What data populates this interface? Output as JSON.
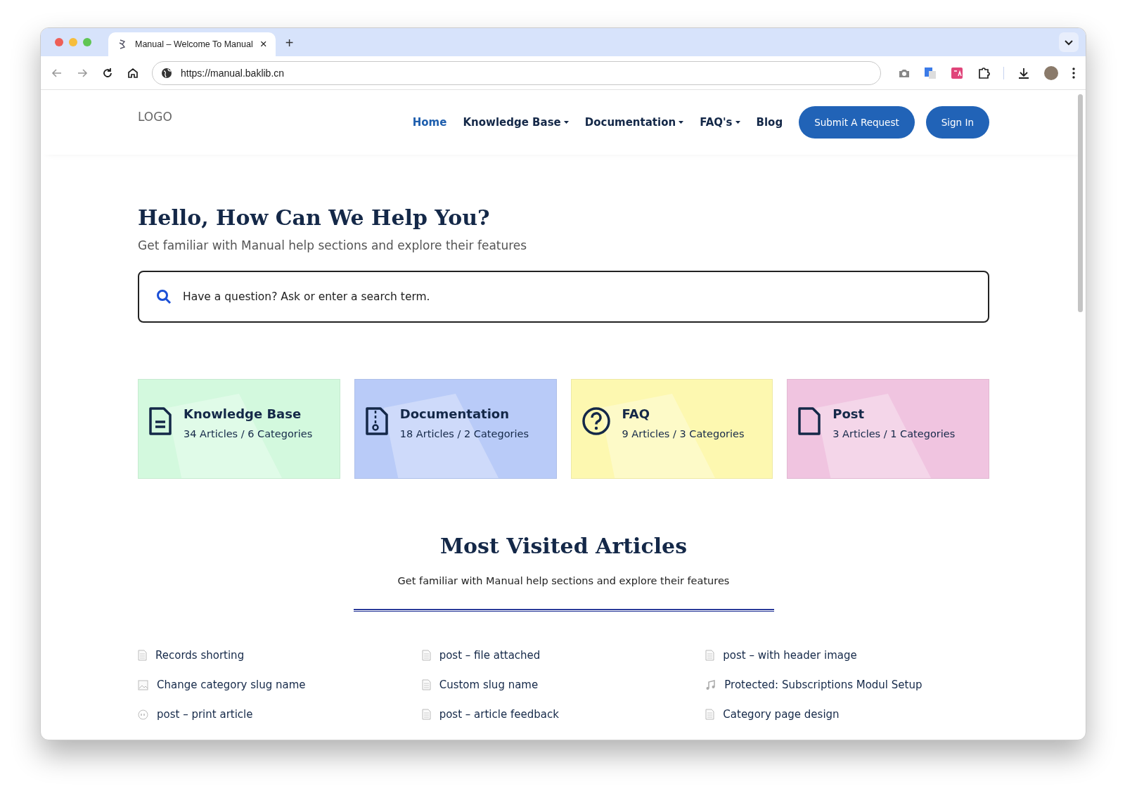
{
  "browser": {
    "tab": {
      "title": "Manual – Welcome To Manual",
      "close": "×"
    },
    "new_tab": "+",
    "address": "https://manual.baklib.cn"
  },
  "header": {
    "logo": "LOGO",
    "nav": [
      {
        "label": "Home",
        "selected": true,
        "dropdown": false
      },
      {
        "label": "Knowledge Base",
        "selected": false,
        "dropdown": true
      },
      {
        "label": "Documentation",
        "selected": false,
        "dropdown": true
      },
      {
        "label": "FAQ's",
        "selected": false,
        "dropdown": true
      },
      {
        "label": "Blog",
        "selected": false,
        "dropdown": false
      }
    ],
    "buttons": [
      "Submit A Request",
      "Sign In"
    ]
  },
  "hero": {
    "title": "Hello, How Can We Help You?",
    "subtitle": "Get familiar with Manual help sections and explore their features",
    "search": {
      "placeholder": "Have a question? Ask or enter a search term."
    }
  },
  "categories": [
    {
      "kind": "document",
      "title": "Knowledge Base",
      "counts": "34 Articles / 6 Categories",
      "color": "#d3f9de"
    },
    {
      "kind": "zip",
      "title": "Documentation",
      "counts": "18 Articles / 2 Categories",
      "color": "#b9cbf8"
    },
    {
      "kind": "question",
      "title": "FAQ",
      "counts": "9 Articles / 3 Categories",
      "color": "#fdf8b0"
    },
    {
      "kind": "file",
      "title": "Post",
      "counts": "3 Articles / 1 Categories",
      "color": "#f0c4e0"
    }
  ],
  "most_visited": {
    "title": "Most Visited Articles",
    "subtitle": "Get familiar with Manual help sections and explore their features",
    "articles": [
      {
        "kind": "document",
        "title": "Records shorting"
      },
      {
        "kind": "document",
        "title": "post – file attached"
      },
      {
        "kind": "document",
        "title": "post – with header image"
      },
      {
        "kind": "image",
        "title": "Change category slug name"
      },
      {
        "kind": "document",
        "title": "Custom slug name"
      },
      {
        "kind": "audio",
        "title": "Protected: Subscriptions Modul Setup"
      },
      {
        "kind": "quote",
        "title": "post – print article"
      },
      {
        "kind": "document",
        "title": "post – article feedback"
      },
      {
        "kind": "document",
        "title": "Category page design"
      }
    ]
  }
}
